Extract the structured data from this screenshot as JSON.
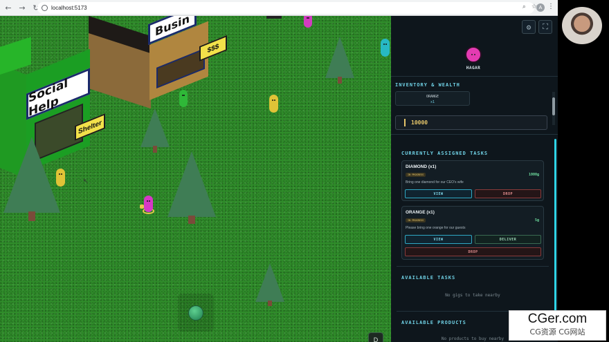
{
  "browser": {
    "url": "localhost:5173",
    "profile_initial": "A"
  },
  "game": {
    "buildings": [
      {
        "sign": "Social Help",
        "subsign": "Shelter"
      },
      {
        "sign": "Busin",
        "subsign": "$$$"
      }
    ],
    "key_hint": "D"
  },
  "player": {
    "name": "HAGAR",
    "color": "#e43bb2"
  },
  "inventory": {
    "title": "INVENTORY & WEALTH",
    "items": [
      {
        "name": "ORANGE",
        "qty": "x1"
      }
    ],
    "wealth": "10000"
  },
  "tasks": {
    "title": "CURRENTLY ASSIGNED TASKS",
    "items": [
      {
        "title": "DIAMOND (x1)",
        "status": "IN PROGRESS",
        "reward": "1000g",
        "desc": "Bring one diamond for our CEO's wife",
        "view": "VIEW",
        "drop": "DROP"
      },
      {
        "title": "ORANGE (x1)",
        "status": "IN PROGRESS",
        "reward": "5g",
        "desc": "Please bring one orange for our guests",
        "view": "VIEW",
        "deliver": "DELIVER",
        "drop": "DROP"
      }
    ]
  },
  "available_tasks": {
    "title": "AVAILABLE TASKS",
    "empty": "No gigs to take nearby"
  },
  "available_products": {
    "title": "AVAILABLE PRODUCTS",
    "empty": "No products to buy nearby"
  },
  "watermark": {
    "line1": "CGer.com",
    "line2": "CG资源 CG网站"
  },
  "colors": {
    "accent": "#6fd0e4",
    "grass": "#2f8c2a",
    "gold": "#e5c56a"
  }
}
